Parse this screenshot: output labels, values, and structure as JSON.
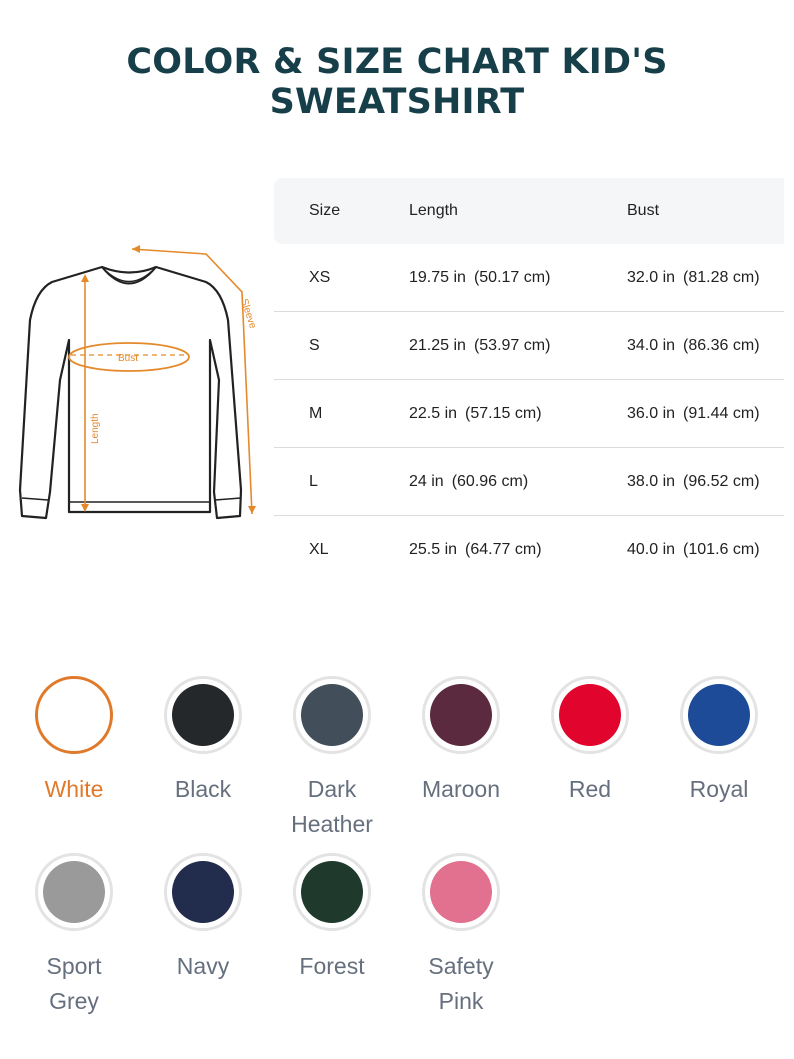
{
  "title": "COLOR & SIZE CHART KID'S SWEATSHIRT",
  "diagram": {
    "labels": {
      "sleeve": "Sleeve",
      "bust": "Bust",
      "length": "Length"
    },
    "accent_color": "#e58a2c"
  },
  "size_table": {
    "headers": {
      "size": "Size",
      "length": "Length",
      "bust": "Bust"
    },
    "rows": [
      {
        "size": "XS",
        "length_in": "19.75 in",
        "length_cm": "(50.17 cm)",
        "bust_in": "32.0 in",
        "bust_cm": "(81.28 cm)"
      },
      {
        "size": "S",
        "length_in": "21.25 in",
        "length_cm": "(53.97 cm)",
        "bust_in": "34.0 in",
        "bust_cm": "(86.36 cm)"
      },
      {
        "size": "M",
        "length_in": "22.5 in",
        "length_cm": "(57.15 cm)",
        "bust_in": "36.0 in",
        "bust_cm": "(91.44 cm)"
      },
      {
        "size": "L",
        "length_in": "24 in",
        "length_cm": "(60.96 cm)",
        "bust_in": "38.0 in",
        "bust_cm": "(96.52 cm)"
      },
      {
        "size": "XL",
        "length_in": "25.5 in",
        "length_cm": "(64.77 cm)",
        "bust_in": "40.0 in",
        "bust_cm": "(101.6 cm)"
      }
    ]
  },
  "colors": [
    {
      "name": "White",
      "hex": "#ffffff",
      "selected": true
    },
    {
      "name": "Black",
      "hex": "#25282b",
      "selected": false
    },
    {
      "name": "Dark Heather",
      "hex": "#424f5a",
      "selected": false
    },
    {
      "name": "Maroon",
      "hex": "#5b2a3e",
      "selected": false
    },
    {
      "name": "Red",
      "hex": "#e1052e",
      "selected": false
    },
    {
      "name": "Royal",
      "hex": "#1d4b98",
      "selected": false
    },
    {
      "name": "Sport Grey",
      "hex": "#9a9a9a",
      "selected": false
    },
    {
      "name": "Navy",
      "hex": "#222d4d",
      "selected": false
    },
    {
      "name": "Forest",
      "hex": "#1f3a2c",
      "selected": false
    },
    {
      "name": "Safety Pink",
      "hex": "#e2708f",
      "selected": false
    }
  ],
  "selected_color": "#e07a2a"
}
